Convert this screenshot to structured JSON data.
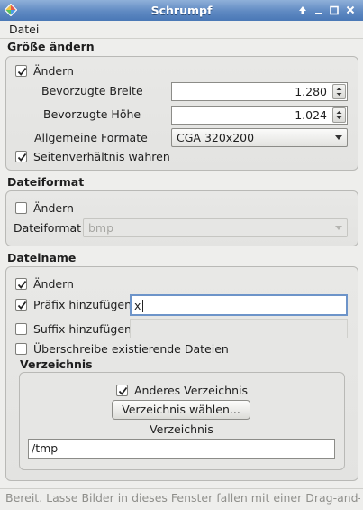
{
  "window": {
    "title": "Schrumpf",
    "controls": [
      "pin",
      "minimize",
      "maximize",
      "close"
    ]
  },
  "menubar": {
    "items": [
      "Datei"
    ]
  },
  "resize": {
    "title": "Größe ändern",
    "enabled": {
      "label": "Ändern",
      "checked": true
    },
    "preferred_width": {
      "label": "Bevorzugte Breite",
      "value": "1.280"
    },
    "preferred_height": {
      "label": "Bevorzugte Höhe",
      "value": "1.024"
    },
    "common_formats": {
      "label": "Allgemeine Formate",
      "selected": "CGA 320x200"
    },
    "keep_aspect": {
      "label": "Seitenverhältnis wahren",
      "checked": true
    }
  },
  "fileformat": {
    "title": "Dateiformat",
    "enabled": {
      "label": "Ändern",
      "checked": false
    },
    "format": {
      "label": "Dateiformat",
      "selected": "bmp",
      "disabled": true
    }
  },
  "filename": {
    "title": "Dateiname",
    "enabled": {
      "label": "Ändern",
      "checked": true
    },
    "prefix": {
      "label": "Präfix hinzufügen",
      "checked": true,
      "value": "x"
    },
    "suffix": {
      "label": "Suffix hinzufügen",
      "checked": false,
      "value": ""
    },
    "overwrite": {
      "label": "Überschreibe existierende Dateien",
      "checked": false
    }
  },
  "directory": {
    "title": "Verzeichnis",
    "other_dir": {
      "label": "Anderes Verzeichnis",
      "checked": true
    },
    "choose_button": "Verzeichnis wählen...",
    "dir_label": "Verzeichnis",
    "dir_value": "/tmp"
  },
  "status": {
    "text": "Bereit. Lasse Bilder in dieses Fenster fallen mit einer Drag-and-Drop-Operation"
  },
  "colors": {
    "titlebar": "#5f89c2",
    "focus": "#6d94c9",
    "background": "#eeeeec"
  }
}
